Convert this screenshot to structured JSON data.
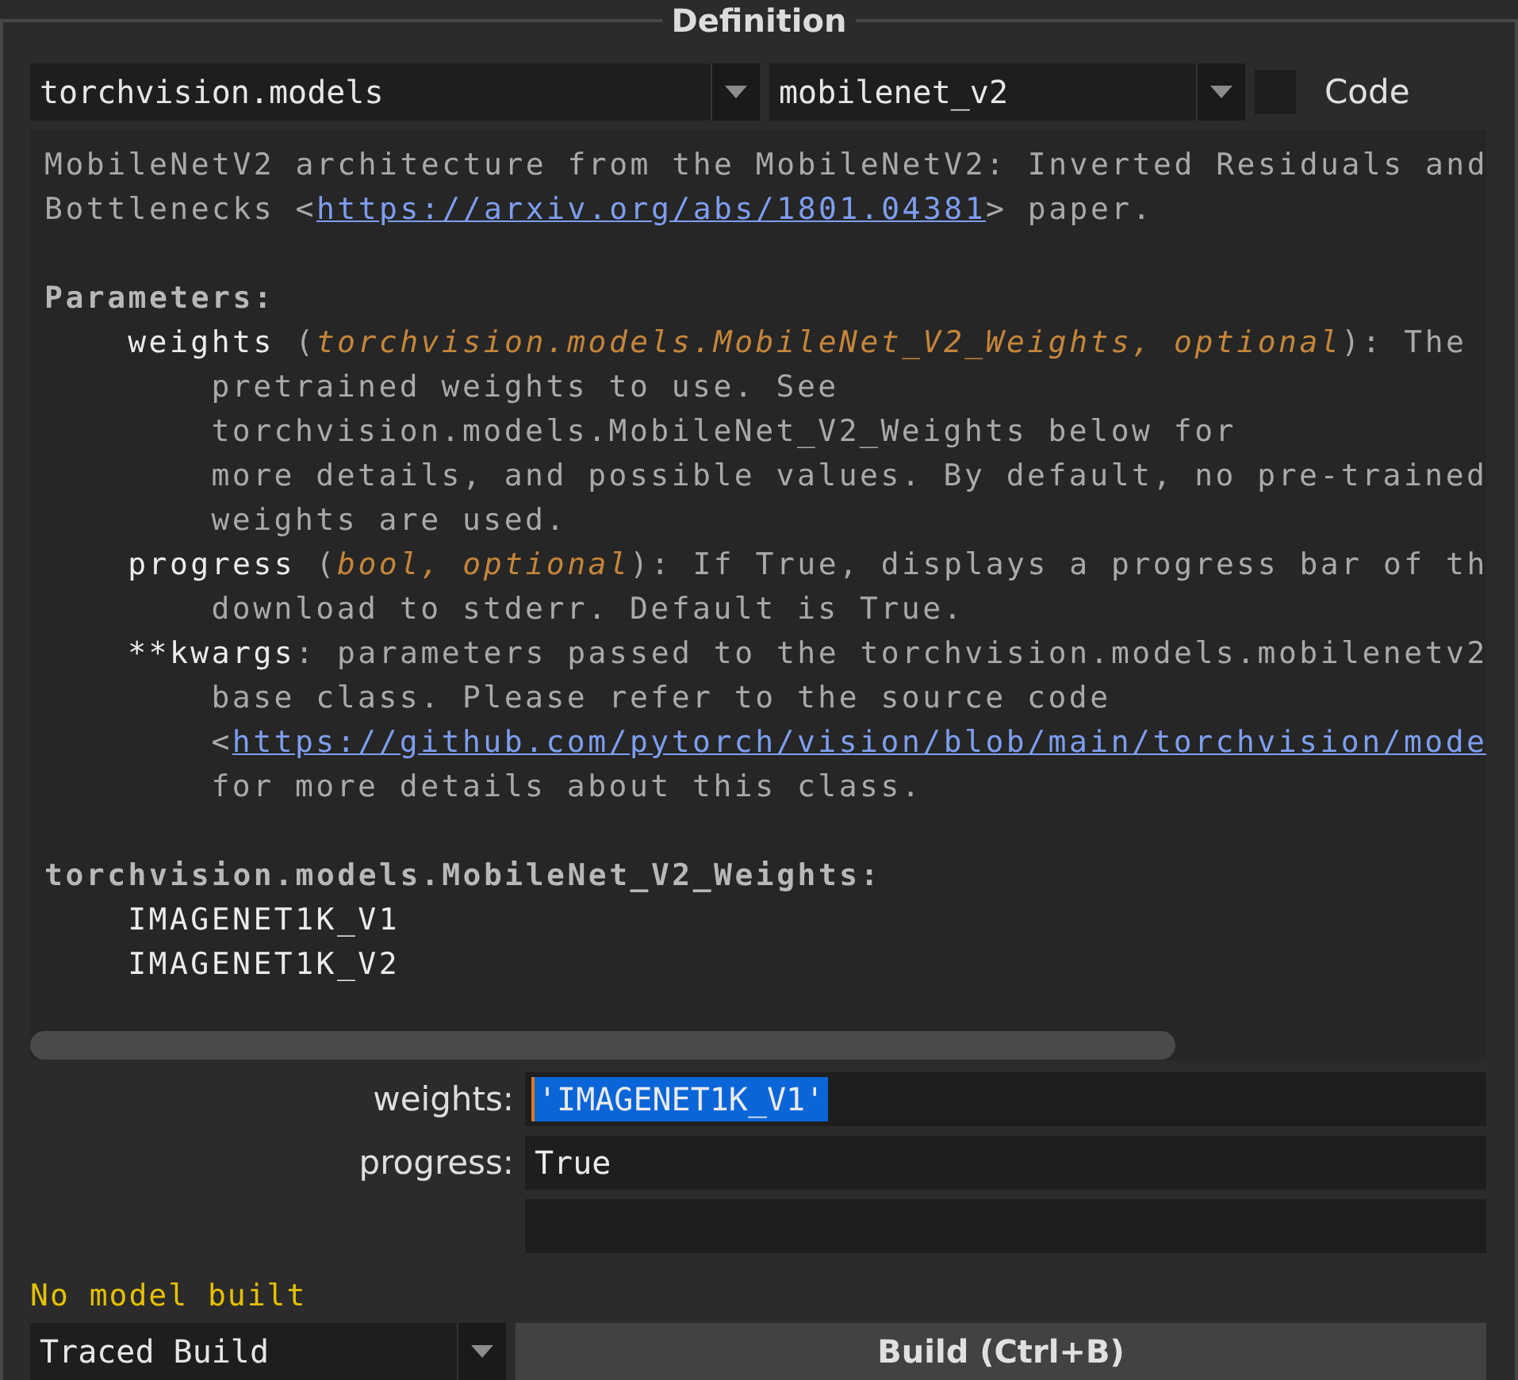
{
  "group": {
    "title": "Definition"
  },
  "module_dropdown": {
    "value": "torchvision.models"
  },
  "model_dropdown": {
    "value": "mobilenet_v2"
  },
  "code_checkbox": {
    "label": "Code",
    "checked": false
  },
  "doc": {
    "intro": [
      [
        {
          "kind": "text",
          "text": "MobileNetV2 architecture from the MobileNetV2: Inverted Residuals and"
        }
      ],
      [
        {
          "kind": "text",
          "text": "Bottlenecks <"
        },
        {
          "kind": "link",
          "text": "https://arxiv.org/abs/1801.04381"
        },
        {
          "kind": "text",
          "text": "> paper."
        }
      ]
    ],
    "sections": [
      {
        "heading": "Parameters:",
        "entries": [
          {
            "lines": [
              [
                {
                  "kind": "name",
                  "text": "weights"
                },
                {
                  "kind": "text",
                  "text": " ("
                },
                {
                  "kind": "type",
                  "text": "torchvision.models.MobileNet_V2_Weights, optional"
                },
                {
                  "kind": "text",
                  "text": "): The"
                }
              ],
              [
                {
                  "kind": "text",
                  "text": "pretrained weights to use. See"
                }
              ],
              [
                {
                  "kind": "text",
                  "text": "torchvision.models.MobileNet_V2_Weights below for"
                }
              ],
              [
                {
                  "kind": "text",
                  "text": "more details, and possible values. By default, no pre-trained"
                }
              ],
              [
                {
                  "kind": "text",
                  "text": "weights are used."
                }
              ]
            ]
          },
          {
            "lines": [
              [
                {
                  "kind": "name",
                  "text": "progress"
                },
                {
                  "kind": "text",
                  "text": " ("
                },
                {
                  "kind": "type",
                  "text": "bool, optional"
                },
                {
                  "kind": "text",
                  "text": "): If True, displays a progress bar of th"
                }
              ],
              [
                {
                  "kind": "text",
                  "text": "download to stderr. Default is True."
                }
              ]
            ]
          },
          {
            "lines": [
              [
                {
                  "kind": "name",
                  "text": "**kwargs"
                },
                {
                  "kind": "text",
                  "text": ": parameters passed to the torchvision.models.mobilenetv2"
                }
              ],
              [
                {
                  "kind": "text",
                  "text": "base class. Please refer to the source code"
                }
              ],
              [
                {
                  "kind": "text",
                  "text": "<"
                },
                {
                  "kind": "link",
                  "text": "https://github.com/pytorch/vision/blob/main/torchvision/mode"
                }
              ],
              [
                {
                  "kind": "text",
                  "text": "for more details about this class."
                }
              ]
            ]
          }
        ]
      },
      {
        "heading": "torchvision.models.MobileNet_V2_Weights:",
        "entries": [
          {
            "lines": [
              [
                {
                  "kind": "name",
                  "text": "IMAGENET1K_V1"
                }
              ]
            ]
          },
          {
            "lines": [
              [
                {
                  "kind": "name",
                  "text": "IMAGENET1K_V2"
                }
              ]
            ]
          }
        ]
      }
    ]
  },
  "fields": [
    {
      "kind": "labeled",
      "label": "weights:",
      "value": "'IMAGENET1K_V1'",
      "highlighted": true
    },
    {
      "kind": "labeled",
      "label": "progress:",
      "value": "True",
      "highlighted": false
    },
    {
      "kind": "empty"
    }
  ],
  "status": "No model built",
  "build_mode_dropdown": {
    "value": "Traced Build"
  },
  "build_button": {
    "label": "Build (Ctrl+B)"
  }
}
